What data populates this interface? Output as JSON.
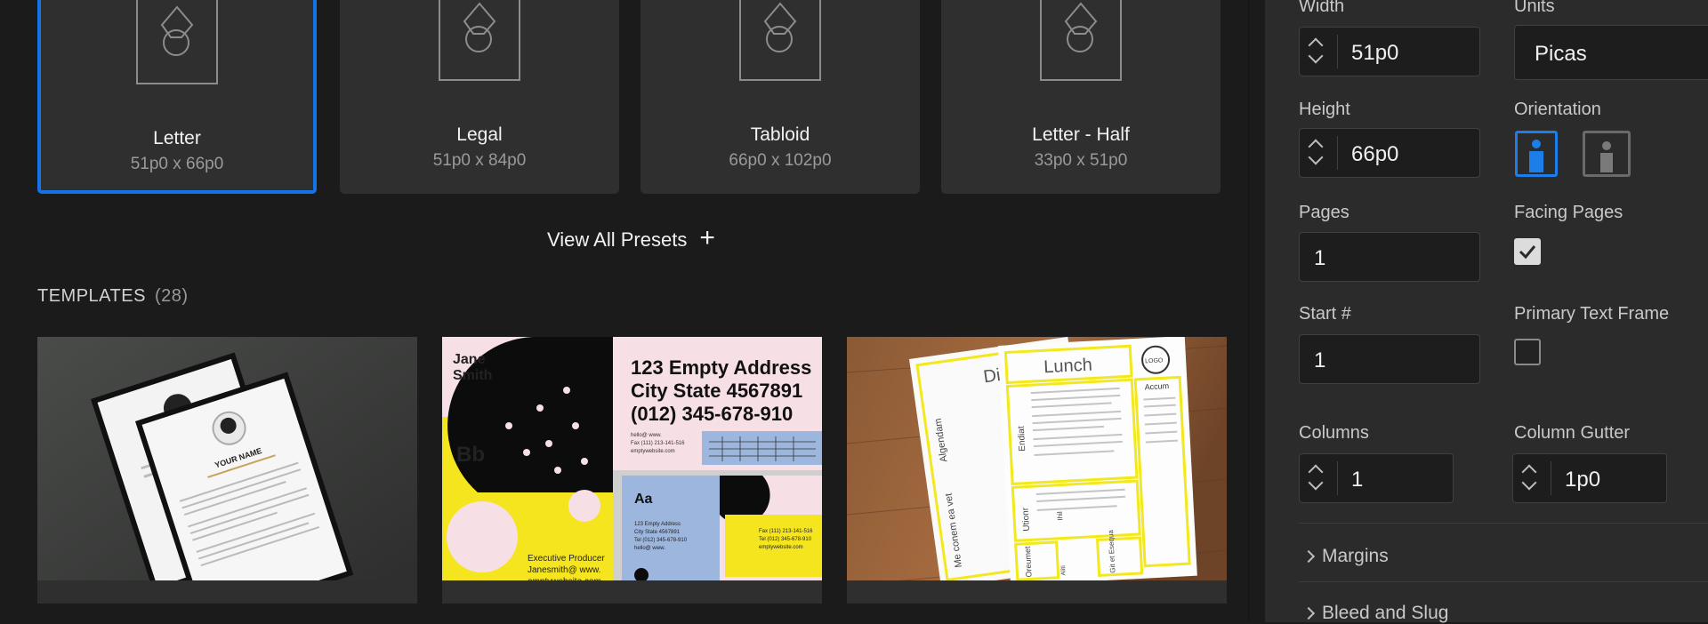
{
  "presets": [
    {
      "name": "Letter",
      "dims": "51p0 x 66p0",
      "selected": true
    },
    {
      "name": "Legal",
      "dims": "51p0 x 84p0",
      "selected": false
    },
    {
      "name": "Tabloid",
      "dims": "66p0 x 102p0",
      "selected": false
    },
    {
      "name": "Letter - Half",
      "dims": "33p0 x 51p0",
      "selected": false
    }
  ],
  "view_all": {
    "label": "View All Presets",
    "icon": "plus-icon"
  },
  "templates": {
    "heading": "TEMPLATES",
    "count": "(28)",
    "items": [
      {
        "name": "resume-template",
        "texts": {
          "your_name": "YOUR NAME"
        }
      },
      {
        "name": "business-card-template",
        "texts": {
          "name_line1": "Jane",
          "name_line2": "Smith",
          "big_letter": "Bb",
          "addr1": "123 Empty Address",
          "addr2": "City State 4567891",
          "phone": "(012) 345-678-910",
          "small_aa": "Aa",
          "role": "Executive Producer",
          "email_line": "Janesmith@ www.",
          "site": "emptywebsite.com",
          "small_hello": "hello@ www.",
          "small_fax": "Fax (111) 213-141-516",
          "small_site": "emptywebsite.com",
          "card2_addr1": "123 Empty Address",
          "card2_addr2": "City State 4567891",
          "card2_phone": "Tel (012) 345-678-910",
          "card2_hello": "hello@ www.",
          "card3_fax": "Fax (111) 213-141-516",
          "card3_tel": "Tel (012) 345-678-910",
          "card3_site": "emptywebsite.com"
        }
      },
      {
        "name": "menu-template",
        "texts": {
          "lunch": "Lunch",
          "din": "Din",
          "logo": "LOGO",
          "accum": "Accum",
          "side1": "Algendam",
          "side2": "Endiat",
          "side3": "Utionr",
          "side4": "Me conem ea vet",
          "side5": "Oreumet",
          "side6": "Git et Esequa",
          "side7": "Ihil",
          "side8": "Aliti"
        }
      }
    ]
  },
  "settings": {
    "width_label": "Width",
    "width_value": "51p0",
    "units_label": "Units",
    "units_value": "Picas",
    "height_label": "Height",
    "height_value": "66p0",
    "orientation_label": "Orientation",
    "pages_label": "Pages",
    "pages_value": "1",
    "facing_label": "Facing Pages",
    "facing_checked": true,
    "start_label": "Start #",
    "start_value": "1",
    "primary_label": "Primary Text Frame",
    "primary_checked": false,
    "columns_label": "Columns",
    "columns_value": "1",
    "gutter_label": "Column Gutter",
    "gutter_value": "1p0",
    "margins_label": "Margins",
    "bleed_label": "Bleed and Slug"
  },
  "colors": {
    "accent": "#1473e6",
    "panel": "#2b2b2b",
    "background": "#1b1b1b"
  }
}
